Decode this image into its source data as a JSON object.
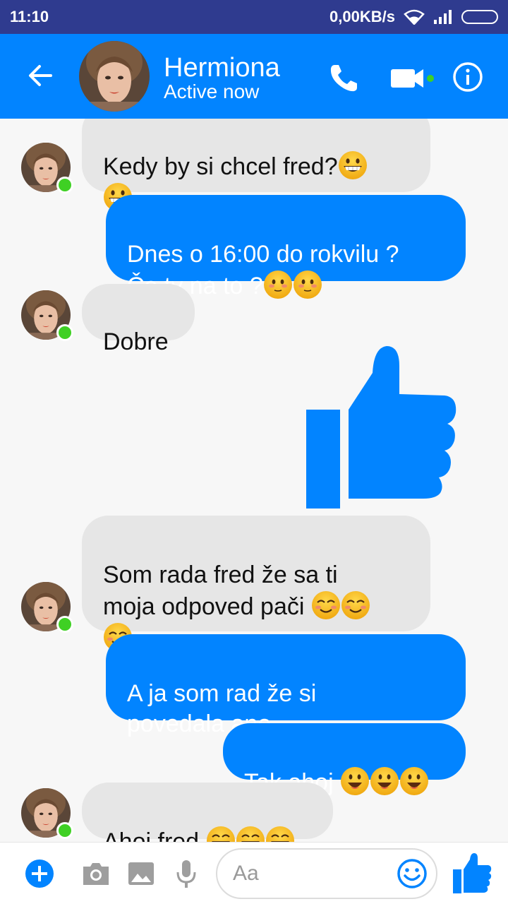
{
  "status_bar": {
    "time": "11:10",
    "network_speed": "0,00KB/s",
    "icons": [
      "wifi-icon",
      "signal-icon",
      "battery-icon"
    ]
  },
  "header": {
    "contact_name": "Hermiona",
    "contact_status": "Active now",
    "icons": [
      "back-arrow-icon",
      "phone-icon",
      "video-camera-icon",
      "info-icon"
    ],
    "accent_color": "#0284ff",
    "status_bar_color": "#2f3b8f"
  },
  "messages": [
    {
      "direction": "incoming",
      "text": "Kedy by si chcel fred?"
    },
    {
      "direction": "outgoing",
      "line1": "Dnes o 16:00 do rokvilu ?",
      "line2": "Čo ty na to ?"
    },
    {
      "direction": "incoming",
      "text": "Dobre"
    },
    {
      "direction": "outgoing",
      "type": "thumbs-up-sticker"
    },
    {
      "direction": "incoming",
      "line1": "Som rada fred že sa ti",
      "line2": "moja odpoved pači "
    },
    {
      "direction": "outgoing",
      "line1": "A ja som rad  že si",
      "line2": "povedala ano ."
    },
    {
      "direction": "outgoing",
      "text": "Tak ahoj "
    },
    {
      "direction": "incoming",
      "text": "Ahoj fred "
    }
  ],
  "composer": {
    "placeholder": "Aa",
    "icons": [
      "plus-icon",
      "camera-icon",
      "image-icon",
      "microphone-icon",
      "emoji-icon",
      "thumbs-up-icon"
    ]
  },
  "colors": {
    "incoming_bubble": "#e6e6e6",
    "outgoing_bubble": "#0284ff",
    "online_dot": "#3fd024",
    "emoji_yellow": "#f7c325"
  }
}
